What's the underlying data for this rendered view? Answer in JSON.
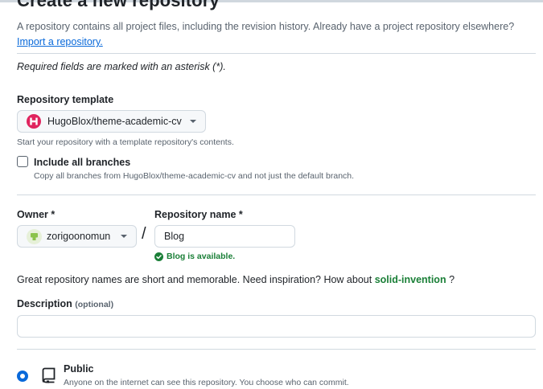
{
  "page": {
    "title": "Create a new repository",
    "intro_text": "A repository contains all project files, including the revision history. Already have a project repository elsewhere?",
    "import_link": "Import a repository.",
    "required_note": "Required fields are marked with an asterisk (*)."
  },
  "template": {
    "label": "Repository template",
    "selected": "HugoBlox/theme-academic-cv",
    "hint": "Start your repository with a template repository's contents.",
    "include_branches_label": "Include all branches",
    "include_branches_checked": false,
    "include_branches_hint": "Copy all branches from HugoBlox/theme-academic-cv and not just the default branch."
  },
  "owner": {
    "label": "Owner *",
    "selected": "zorigoonomun",
    "separator": "/"
  },
  "repo_name": {
    "label": "Repository name *",
    "value": "Blog",
    "availability": "Blog is available."
  },
  "suggestion": {
    "text": "Great repository names are short and memorable. Need inspiration? How about",
    "name": "solid-invention",
    "trail": "?"
  },
  "description": {
    "label": "Description",
    "optional": "(optional)",
    "value": ""
  },
  "visibility": {
    "public_label": "Public",
    "public_desc": "Anyone on the internet can see this repository. You choose who can commit.",
    "public_selected": true
  },
  "colors": {
    "accent": "#0969da",
    "success": "#1a7f37",
    "template_icon": "#e0245e",
    "avatar": "#8bc34a"
  },
  "icons": {
    "template": "hugoblox-logo-icon",
    "owner": "user-avatar-icon",
    "available": "check-circle-icon",
    "public": "repo-icon"
  }
}
